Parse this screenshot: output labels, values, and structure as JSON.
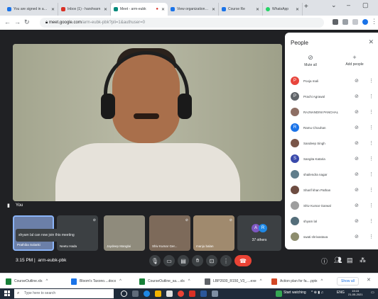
{
  "browser": {
    "tabs": [
      {
        "title": "You are signed in as to",
        "color": "#1a73e8"
      },
      {
        "title": "Inbox (1) - harshvarn",
        "color": "#d93025"
      },
      {
        "title": "Meet - arm-eubk",
        "color": "#00897b",
        "active": true
      },
      {
        "title": "View organizational c",
        "color": "#1a73e8"
      },
      {
        "title": "Course Re",
        "color": "#1a73e8"
      },
      {
        "title": "WhatsApp",
        "color": "#25d366"
      }
    ],
    "new_tab": "+",
    "url_host": "meet.google.com",
    "url_path": "/arm-eubk-pbk?pli=1&authuser=0",
    "window_controls": [
      "⌄",
      "–",
      "▢"
    ]
  },
  "meeting": {
    "main_speaker_label": "You",
    "time": "3:15 PM",
    "meeting_code": "arm-eubk-pbk",
    "toast": "shyam lal can now join this meeting",
    "thumbnails": [
      {
        "name": "Prathiba Solanki"
      },
      {
        "name": "Neetu Hada"
      },
      {
        "name": "Jaydeep Manglai"
      },
      {
        "name": "Shiv Kumar Ger..."
      },
      {
        "name": "manju balan"
      }
    ],
    "others": {
      "label": "37 others",
      "initials": [
        "A",
        "R"
      ]
    }
  },
  "people_panel": {
    "title": "People",
    "mute_all": "Mute all",
    "add_people": "Add people",
    "participants": [
      {
        "name": "Pooja mali",
        "initial": "P",
        "color": "#e8453c"
      },
      {
        "name": "Prachi Agrawal",
        "initial": "P",
        "color": "#5f6368"
      },
      {
        "name": "RAJNANDINI PANCHAL",
        "initial": "",
        "color": "#8d6e63"
      },
      {
        "name": "Ramu Chouhan",
        "initial": "R",
        "color": "#1a73e8"
      },
      {
        "name": "Sandeep Singh",
        "initial": "",
        "color": "#795548"
      },
      {
        "name": "Sangita Kataria",
        "initial": "S",
        "color": "#3949ab"
      },
      {
        "name": "shailendra nagar",
        "initial": "",
        "color": "#607d8b"
      },
      {
        "name": "Sharif khan Pathan",
        "initial": "",
        "color": "#6d4c41"
      },
      {
        "name": "Shiv Kumar Garwal",
        "initial": "",
        "color": "#9e9e9e"
      },
      {
        "name": "shyam lal",
        "initial": "",
        "color": "#546e7a"
      },
      {
        "name": "swati shrivastava",
        "initial": "",
        "color": "#8d8d6e"
      }
    ]
  },
  "downloads": [
    {
      "name": "CourseOutline.xls"
    },
    {
      "name": "Bloom's Taxono....docx"
    },
    {
      "name": "CourseOutline_sa....xls"
    },
    {
      "name": "LBP2600_R150_V3_....exe"
    },
    {
      "name": "Action plan for fa....pptx"
    }
  ],
  "show_all": "Show all",
  "taskbar": {
    "search_placeholder": "Type here to search",
    "tray_text": "Start watching",
    "language": "ENG",
    "clock_time": "15:15",
    "clock_date": "21-05-2021"
  }
}
